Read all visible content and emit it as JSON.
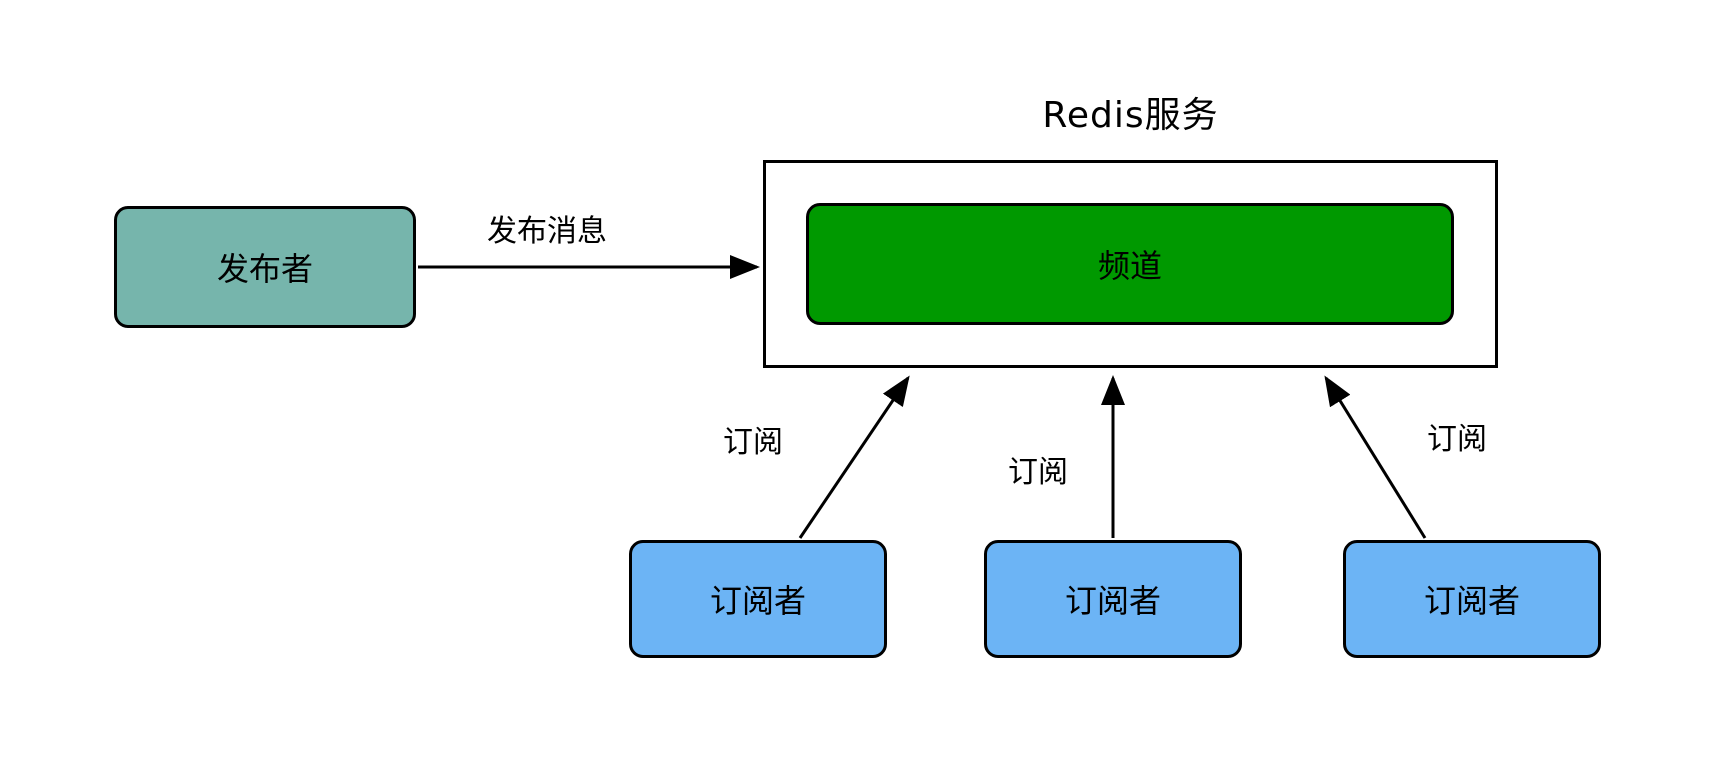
{
  "diagram": {
    "title": "Redis服务",
    "nodes": {
      "publisher": {
        "label": "发布者",
        "color": "#76b5ac"
      },
      "service": {
        "label": "Redis服务",
        "color": "#ffffff"
      },
      "channel": {
        "label": "频道",
        "color": "#009900"
      },
      "subscribers": [
        {
          "label": "订阅者",
          "color": "#6cb4f5"
        },
        {
          "label": "订阅者",
          "color": "#6cb4f5"
        },
        {
          "label": "订阅者",
          "color": "#6cb4f5"
        }
      ]
    },
    "edges": [
      {
        "label": "发布消息",
        "from": "publisher",
        "to": "service"
      },
      {
        "label": "订阅",
        "from": "subscriber-1",
        "to": "service"
      },
      {
        "label": "订阅",
        "from": "subscriber-2",
        "to": "service"
      },
      {
        "label": "订阅",
        "from": "subscriber-3",
        "to": "service"
      }
    ],
    "stroke_color": "#000000",
    "background": "#ffffff"
  }
}
